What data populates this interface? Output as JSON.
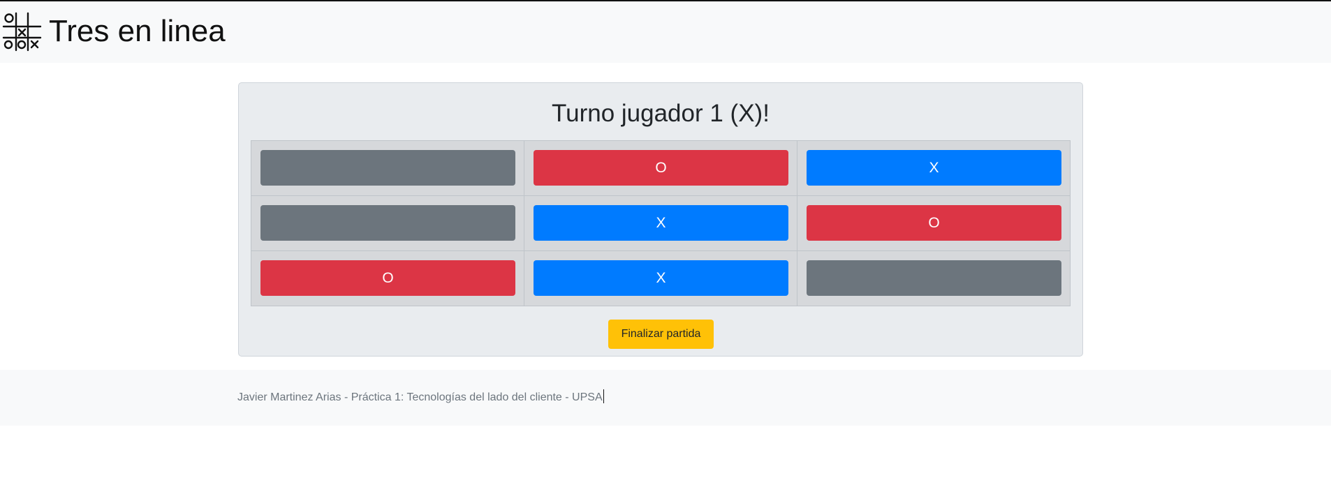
{
  "header": {
    "title": "Tres en linea",
    "logo_icon": "tic-tac-toe-icon"
  },
  "game": {
    "turn_text": "Turno jugador 1 (X)!",
    "board": [
      [
        "",
        "O",
        "X"
      ],
      [
        "",
        "X",
        "O"
      ],
      [
        "O",
        "X",
        ""
      ]
    ],
    "finish_label": "Finalizar partida"
  },
  "footer": {
    "text": "Javier Martinez Arias - Práctica 1: Tecnologías del lado del cliente - UPSA"
  },
  "colors": {
    "empty": "#6c757d",
    "O": "#dc3545",
    "X": "#007bff",
    "warning": "#ffc107"
  }
}
